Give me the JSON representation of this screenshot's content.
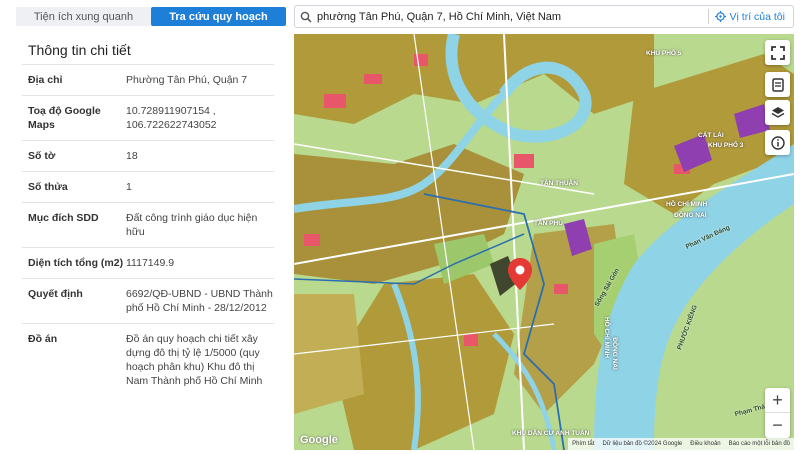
{
  "tabs": {
    "utilities": "Tiện ích xung quanh",
    "planning": "Tra cứu quy hoạch"
  },
  "search": {
    "value": "phường Tân Phú, Quận 7, Hồ Chí Minh, Việt Nam",
    "locate_label": "Vị trí của tôi"
  },
  "panel": {
    "title": "Thông tin chi tiết",
    "rows": [
      {
        "key": "Địa chỉ",
        "value": "Phường Tân Phú, Quận 7"
      },
      {
        "key": "Toạ độ Google Maps",
        "value": "10.728911907154 , 106.722622743052"
      },
      {
        "key": "Số tờ",
        "value": "18"
      },
      {
        "key": "Số thửa",
        "value": "1"
      },
      {
        "key": "Mục đích SDD",
        "value": "Đất công trình giáo dục hiện hữu"
      },
      {
        "key": "Diện tích tổng (m2)",
        "value": "1117149.9"
      },
      {
        "key": "Quyết định",
        "value": "6692/QĐ-UBND - UBND Thành phố Hồ Chí Minh - 28/12/2012"
      },
      {
        "key": "Đồ án",
        "value": "Đồ án quy hoạch chi tiết xây dựng đô thị tỷ lệ 1/5000 (quy hoạch phân khu) Khu đô thị Nam Thành phố Hồ Chí Minh"
      }
    ]
  },
  "map": {
    "labels": {
      "khu_pho_5": "KHU PHỐ 5",
      "cat_lai": "CÁT LÁI",
      "khu_pho_3": "KHU PHỐ 3",
      "ho_chi_minh": "HỒ CHÍ MINH",
      "dong_nai": "ĐỒNG NAI",
      "tan_phu": "TÂN PHÚ",
      "tan_thuan": "TÂN THUẬN",
      "ho_chi_minh_v": "HỒ CHÍ MINH",
      "dong_nai_v": "ĐỒNG NAI",
      "anh_tuan": "KHU DÂN CƯ ANH TUẤN",
      "phuoc_kieng": "PHƯỚC KIỂNG",
      "phan_van_dong": "Phan Văn Đáng",
      "pham_thai_buong": "Phạm Thái Bường",
      "song_sai_gon": "Sông Sài Gòn"
    },
    "google": "Google",
    "attribution": [
      "Phím tắt",
      "Dữ liệu bản đồ ©2024 Google",
      "Điều khoản",
      "Báo cáo một lỗi bản đồ"
    ],
    "colors": {
      "residential": "#b09a3a",
      "green": "#b7d88a",
      "river": "#8fd3e6",
      "road": "#ffffff",
      "commercial": "#e8566a",
      "industrial": "#8f3fb0",
      "pin": "#e53935",
      "accent": "#1e7fd8"
    }
  }
}
